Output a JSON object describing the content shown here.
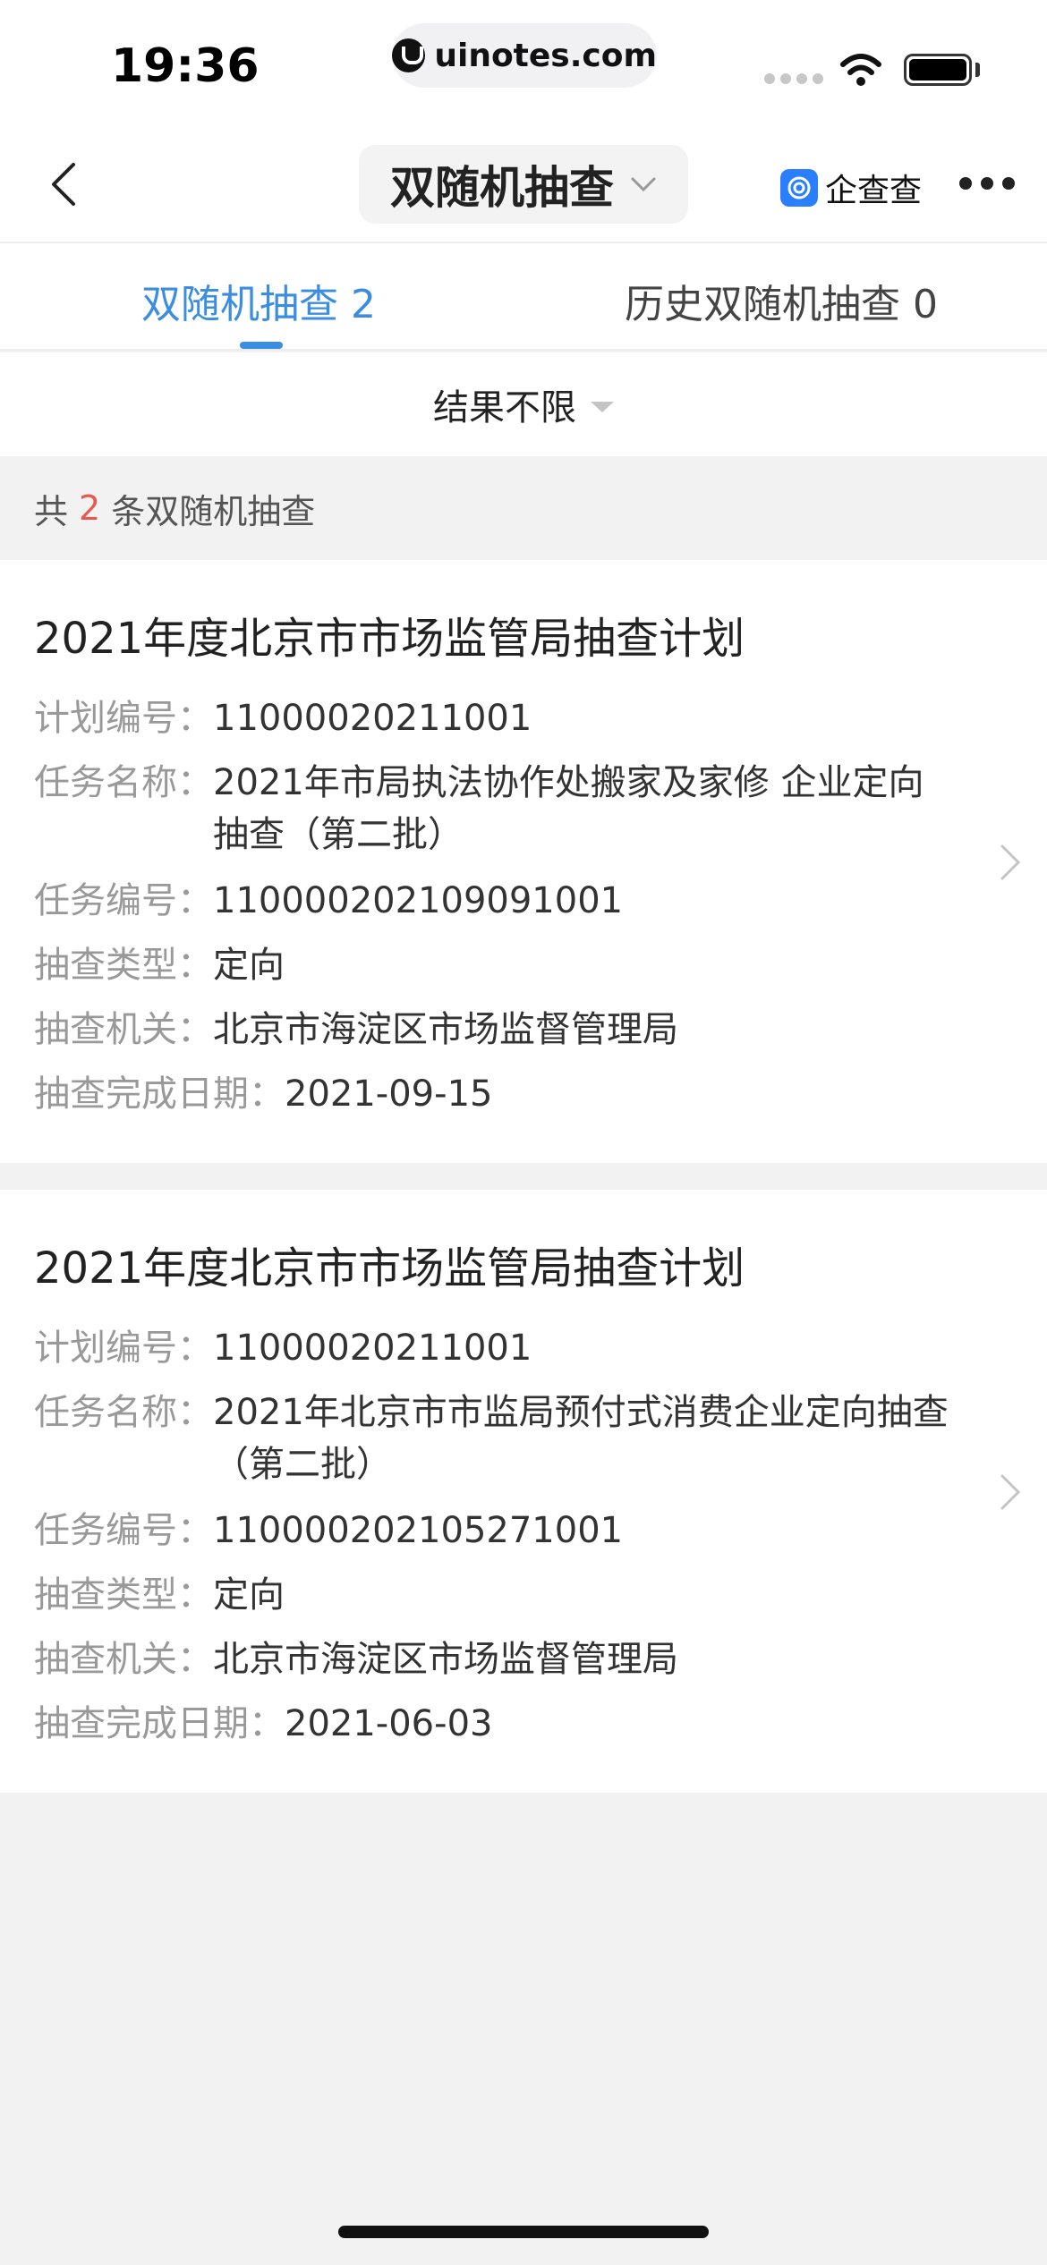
{
  "status_bar": {
    "time": "19:36",
    "url": "uinotes.com"
  },
  "nav": {
    "title": "双随机抽查",
    "brand": "企查查",
    "icons": [
      "back-icon",
      "chevron-down-icon",
      "brand-logo-icon",
      "more-icon"
    ]
  },
  "tabs": [
    {
      "label": "双随机抽查 2",
      "active": true
    },
    {
      "label": "历史双随机抽查 0",
      "active": false
    }
  ],
  "filter": {
    "label": "结果不限"
  },
  "summary": {
    "prefix": "共",
    "count": "2",
    "suffix": "条双随机抽查"
  },
  "colors": {
    "accent": "#3a8de0",
    "count_highlight": "#e55a4e",
    "background": "#f2f2f2"
  },
  "records": [
    {
      "title": "2021年度北京市市场监管局抽查计划",
      "plan_no_label": "计划编号：",
      "plan_no": "11000020211001",
      "task_name_label": "任务名称：",
      "task_name": "2021年市局执法协作处搬家及家修 企业定向抽查（第二批）",
      "task_no_label": "任务编号：",
      "task_no": "110000202109091001",
      "type_label": "抽查类型：",
      "type": "定向",
      "authority_label": "抽查机关：",
      "authority": "北京市海淀区市场监督管理局",
      "date_label": "抽查完成日期：",
      "date": "2021-09-15"
    },
    {
      "title": "2021年度北京市市场监管局抽查计划",
      "plan_no_label": "计划编号：",
      "plan_no": "11000020211001",
      "task_name_label": "任务名称：",
      "task_name": "2021年北京市市监局预付式消费企业定向抽查 （第二批）",
      "task_no_label": "任务编号：",
      "task_no": "110000202105271001",
      "type_label": "抽查类型：",
      "type": "定向",
      "authority_label": "抽查机关：",
      "authority": "北京市海淀区市场监督管理局",
      "date_label": "抽查完成日期：",
      "date": "2021-06-03"
    }
  ]
}
